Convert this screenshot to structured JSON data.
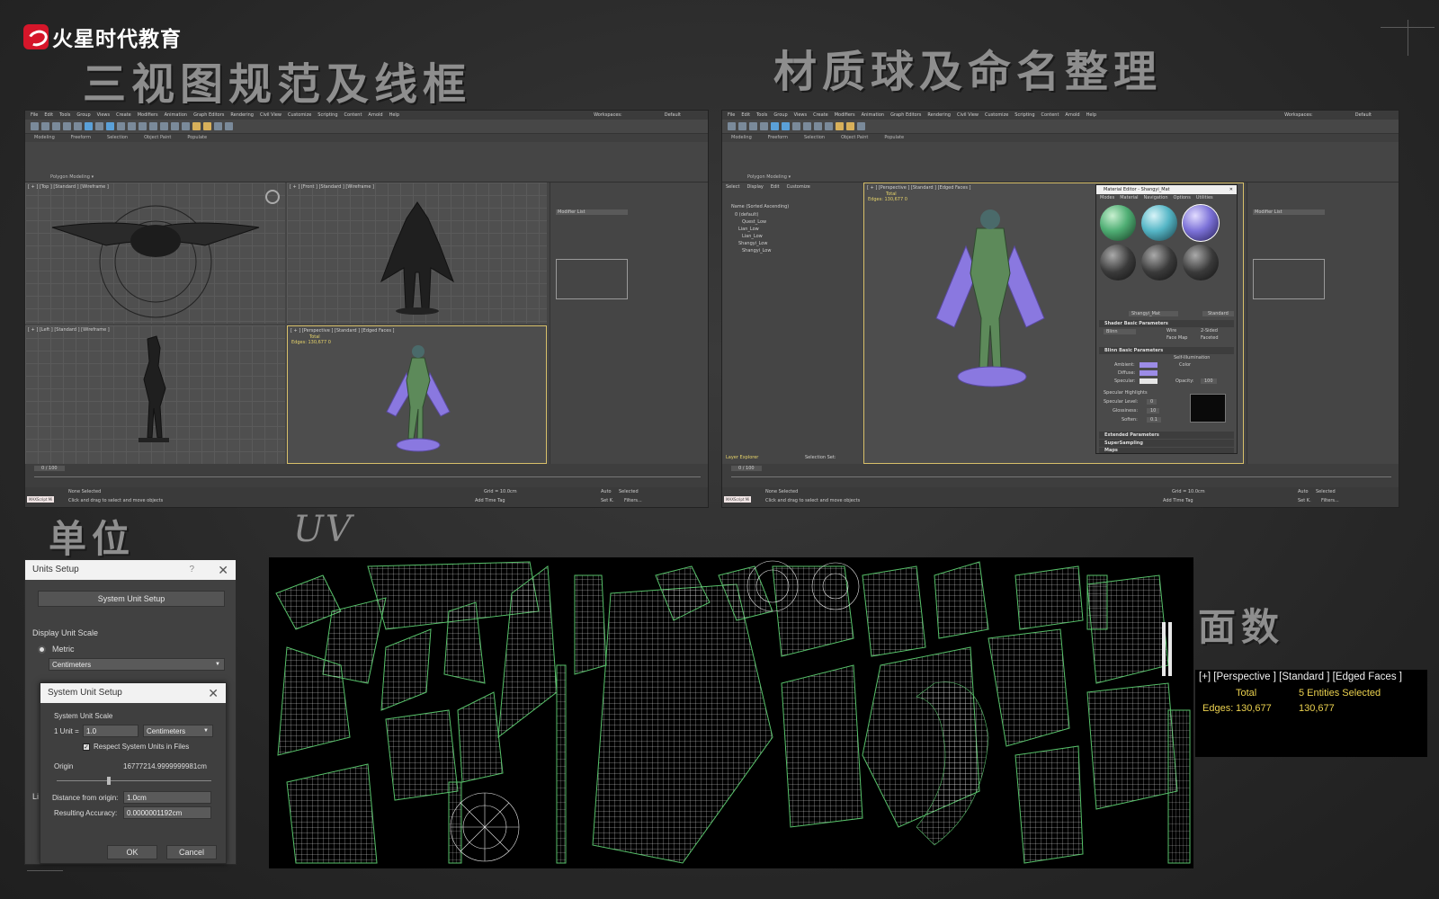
{
  "logo": {
    "text": "火星时代教育"
  },
  "headings": {
    "three_views": "三视图规范及线框",
    "materials": "材质球及命名整理",
    "units": "单位",
    "uv": "UV",
    "face_count": "面数"
  },
  "max_left": {
    "menu": [
      "File",
      "Edit",
      "Tools",
      "Group",
      "Views",
      "Create",
      "Modifiers",
      "Animation",
      "Graph Editors",
      "Rendering",
      "Civil View",
      "Customize",
      "Scripting",
      "Content",
      "Arnold",
      "Help"
    ],
    "ribbon_tabs": [
      "Modeling",
      "Freeform",
      "Selection",
      "Object Paint",
      "Populate"
    ],
    "ribbon_label": "Polygon Modeling ▾",
    "workspace_label": "Workspaces:",
    "workspace_value": "Default",
    "viewports": {
      "top": "[ + ] [Top ] [Standard ] [Wireframe ]",
      "front": "[ + ] [Front ] [Standard ] [Wireframe ]",
      "left": "[ + ] [Left ] [Standard ] [Wireframe ]",
      "persp": "[ + ] [Perspective ] [Standard ] [Edged Faces ]",
      "persp_total": "Total",
      "persp_edges": "Edges:  130,677      0"
    },
    "modifier_list": "Modifier List",
    "frame": "0 / 100",
    "status_none": "None Selected",
    "status_hint": "Click and drag to select and move objects",
    "maxscript": "MAXScript Mi",
    "grid": "Grid = 10.0cm",
    "add_time_tag": "Add Time Tag",
    "auto": "Auto",
    "selected": "Selected",
    "set_k": "Set K.",
    "filters": "Filters..."
  },
  "max_right": {
    "scene_explorer": {
      "menu": [
        "Select",
        "Display",
        "Edit",
        "Customize"
      ],
      "header": "Name (Sorted Ascending)",
      "items": [
        "0 (default)",
        "Quest_Low",
        "Lian_Low",
        "Lian_Low",
        "Shangyi_Low",
        "Shangyi_Low"
      ],
      "footer": "Layer Explorer",
      "selection_set": "Selection Set:"
    },
    "viewport": {
      "label": "[ + ] [Perspective ] [Standard ] [Edged Faces ]",
      "total": "Total",
      "edges": "Edges:  130,677      0"
    },
    "material_editor": {
      "title": "Material Editor - Shangyi_Mat",
      "menu": [
        "Modes",
        "Material",
        "Navigation",
        "Options",
        "Utilities"
      ],
      "mat_name": "Shangyi_Mat",
      "mat_type": "Standard",
      "rollouts": {
        "shader_basic": "Shader Basic Parameters",
        "shader": "Blinn",
        "wire": "Wire",
        "two_sided": "2-Sided",
        "face_map": "Face Map",
        "faceted": "Faceted",
        "blinn_basic": "Blinn Basic Parameters",
        "self_illum": "Self-Illumination",
        "color": "Color",
        "ambient": "Ambient:",
        "diffuse": "Diffuse:",
        "specular": "Specular:",
        "opacity": "Opacity:",
        "opacity_val": "100",
        "spec_highlights": "Specular Highlights",
        "spec_level": "Specular Level:",
        "spec_level_val": "0",
        "glossiness": "Glossiness:",
        "glossiness_val": "10",
        "soften": "Soften:",
        "soften_val": "0.1",
        "extended": "Extended Parameters",
        "supersampling": "SuperSampling",
        "maps": "Maps"
      },
      "sphere_colors": [
        "#4fae74",
        "#55b6c6",
        "#7c72d8",
        "#3a3a3a",
        "#3a3a3a",
        "#3a3a3a"
      ]
    }
  },
  "units_setup": {
    "title": "Units Setup",
    "help": "?",
    "system_unit_setup_btn": "System Unit Setup",
    "display_unit_scale": "Display Unit Scale",
    "metric": "Metric",
    "metric_unit": "Centimeters",
    "lighting": "Li"
  },
  "system_unit_setup": {
    "title": "System Unit Setup",
    "system_unit_scale": "System Unit Scale",
    "one_unit": "1 Unit =",
    "unit_value": "1.0",
    "unit_type": "Centimeters",
    "respect": "Respect System Units in Files",
    "origin": "Origin",
    "origin_value": "16777214.9999999981cm",
    "distance_label": "Distance from origin:",
    "distance_value": "1.0cm",
    "accuracy_label": "Resulting Accuracy:",
    "accuracy_value": "0.0000001192cm",
    "ok": "OK",
    "cancel": "Cancel"
  },
  "face_count": {
    "viewport_label": "[+] [Perspective ] [Standard ] [Edged Faces ]",
    "total": "Total",
    "selected": "5 Entities Selected",
    "edges_label": "Edges:",
    "edges_total": "130,677",
    "edges_selected": "130,677"
  },
  "colors": {
    "accent_yellow": "#ecd24f",
    "uv_wire": "#e8e8e8",
    "uv_seam": "#57c26a",
    "character_purple": "#8a78e0",
    "brand_red": "#d5162a"
  }
}
